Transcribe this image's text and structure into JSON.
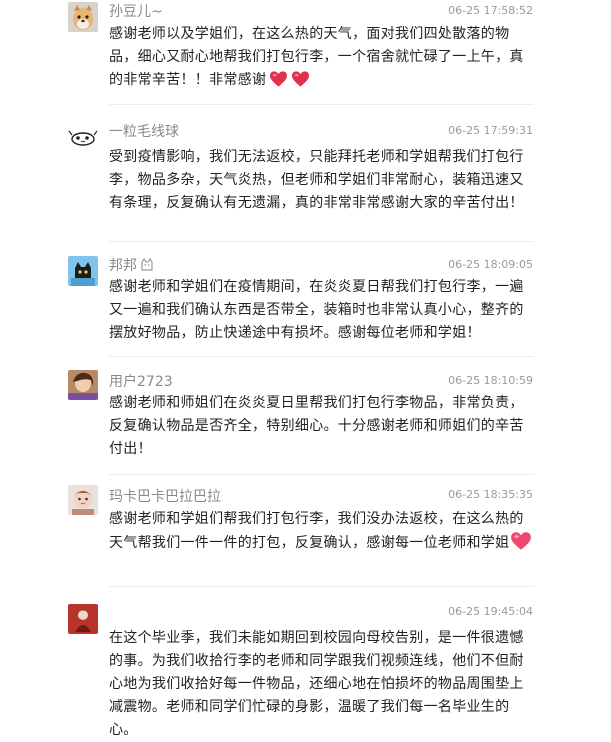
{
  "comments": [
    {
      "user": "孙豆儿~",
      "time": "06-25 17:58:52",
      "text": "感谢老师以及学姐们，在这么热的天气，面对我们四处散落的物品，细心又耐心地帮我们打包行李，一个宿舍就忙碌了一上午，真的非常辛苦！！非常感谢",
      "emoji": [
        "heart-emoji",
        "heart-emoji"
      ]
    },
    {
      "user": "一粒毛线球",
      "time": "06-25 17:59:31",
      "text": "受到疫情影响，我们无法返校，只能拜托老师和学姐帮我们打包行李，物品多杂，天气炎热，但老师和学姐们非常耐心，装箱迅速又有条理，反复确认有无遗漏，真的非常非常感谢大家的辛苦付出！"
    },
    {
      "user": "邦邦",
      "time": "06-25 18:09:05",
      "text": "感谢老师和学姐们在疫情期间，在炎炎夏日帮我们打包行李，一遍又一遍和我们确认东西是否带全，装箱时也非常认真小心，整齐的摆放好物品，防止快递途中有损坏。感谢每位老师和学姐！"
    },
    {
      "user": "用户2723",
      "time": "06-25 18:10:59",
      "text": "感谢老师和师姐们在炎炎夏日里帮我们打包行李物品，非常负责，反复确认物品是否齐全，特别细心。十分感谢老师和师姐们的辛苦付出！"
    },
    {
      "user": "玛卡巴卡巴拉巴拉",
      "time": "06-25 18:35:35",
      "text": "感谢老师和学姐们帮我们打包行李，我们没办法返校，在这么热的天气帮我们一件一件的打包，反复确认，感谢每一位老师和学姐",
      "emoji": [
        "heart-emoji"
      ]
    },
    {
      "user": "",
      "time": "06-25 19:45:04",
      "text": "在这个毕业季，我们未能如期回到校园向母校告别，是一件很遗憾的事。为我们收拾行李的老师和同学跟我们视频连线，他们不但耐心地为我们收拾好每一件物品，还细心地在怕损坏的物品周围垫上减震物。老师和同学们忙碌的身影，温暖了我们每一名毕业生的心。"
    }
  ],
  "colors": {
    "name": "#8a8a8a",
    "time": "#9a9a9a",
    "text": "#222222",
    "heart": "#e0324f",
    "divider": "#ececec"
  }
}
